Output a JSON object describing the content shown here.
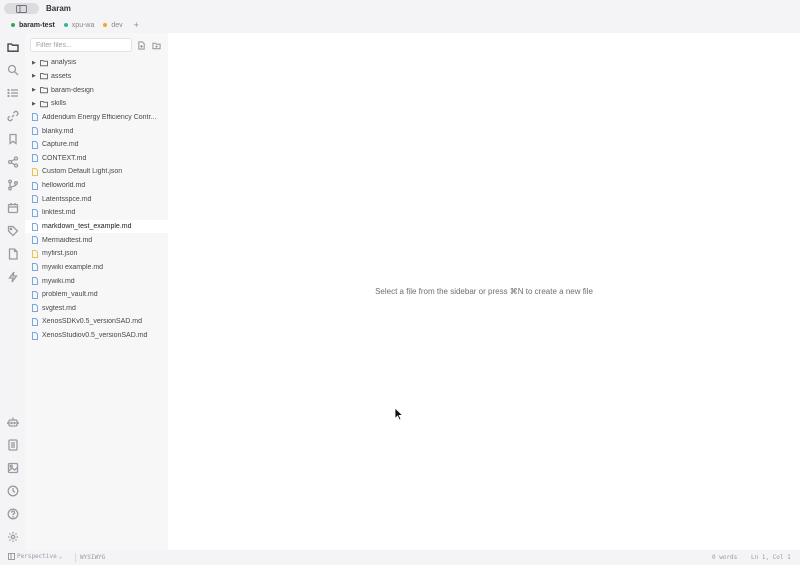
{
  "app": {
    "title": "Baram"
  },
  "tabs": [
    {
      "label": "baram-test",
      "color": "#34a853",
      "active": true
    },
    {
      "label": "xpu-wa",
      "color": "#34b5a0",
      "active": false
    },
    {
      "label": "dev",
      "color": "#f5a623",
      "active": false
    }
  ],
  "tab_add_label": "+",
  "activity_icons": [
    "folder-icon",
    "search-icon",
    "list-icon",
    "link-icon",
    "bookmark-icon",
    "share-icon",
    "git-branch-icon",
    "calendar-icon",
    "tag-icon",
    "file-icon",
    "lightning-icon",
    "robot-icon",
    "document-icon",
    "image-icon",
    "clock-icon",
    "help-icon",
    "settings-icon"
  ],
  "sidebar": {
    "filter_placeholder": "Filter files...",
    "folders": [
      {
        "label": "analysis"
      },
      {
        "label": "assets"
      },
      {
        "label": "baram-design"
      },
      {
        "label": "skills"
      }
    ],
    "files": [
      {
        "label": "Addendum Energy Efficiency Contr...",
        "type": "md"
      },
      {
        "label": "blanky.md",
        "type": "md"
      },
      {
        "label": "Capture.md",
        "type": "md"
      },
      {
        "label": "CONTEXT.md",
        "type": "md"
      },
      {
        "label": "Custom Default Light.json",
        "type": "json"
      },
      {
        "label": "helloworld.md",
        "type": "md"
      },
      {
        "label": "Latentsspce.md",
        "type": "md"
      },
      {
        "label": "linktest.md",
        "type": "md"
      },
      {
        "label": "markdown_test_example.md",
        "type": "md",
        "selected": true
      },
      {
        "label": "Mermaidtest.md",
        "type": "md"
      },
      {
        "label": "myfirst.json",
        "type": "json"
      },
      {
        "label": "mywiki example.md",
        "type": "md"
      },
      {
        "label": "mywiki.md",
        "type": "md"
      },
      {
        "label": "problem_vault.md",
        "type": "md"
      },
      {
        "label": "svgtest.md",
        "type": "md"
      },
      {
        "label": "XenosSDKv0.5_versionSAD.md",
        "type": "md"
      },
      {
        "label": "XenosStudiov0.5_versionSAD.md",
        "type": "md"
      }
    ]
  },
  "editor": {
    "empty_message": "Select a file from the sidebar or press ⌘N to create a new file"
  },
  "statusbar": {
    "perspective": "Perspective",
    "mode": "WYSIWYG",
    "words": "0 words",
    "cursor": "Ln 1, Col 1"
  },
  "colors": {
    "md_icon": "#7aa7e0",
    "json_icon": "#e8c25a",
    "folder_icon": "#6e6e73"
  }
}
